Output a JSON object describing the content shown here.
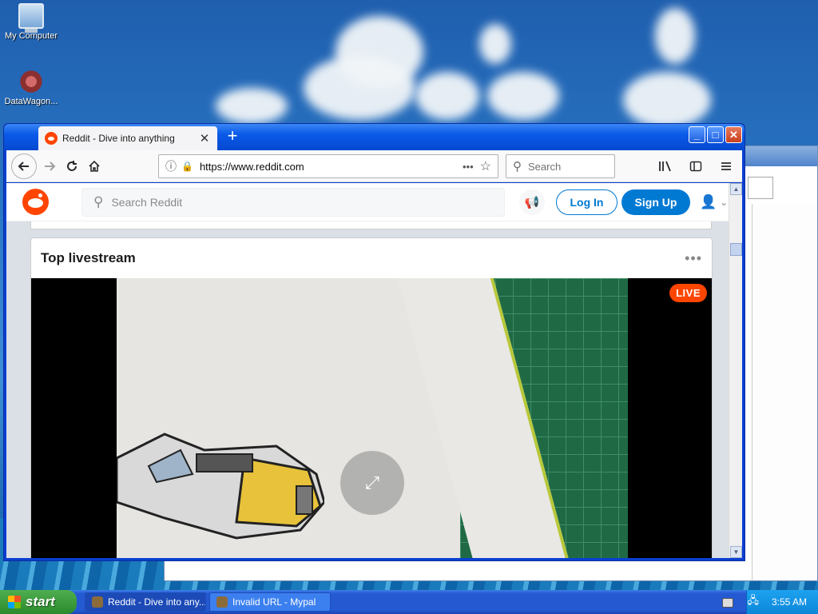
{
  "desktop": {
    "icons": [
      {
        "label": "My Computer"
      },
      {
        "label": "DataWagon..."
      }
    ]
  },
  "browser": {
    "tab_title": "Reddit - Dive into anything",
    "tab_close": "✕",
    "new_tab": "+",
    "url": "https://www.reddit.com",
    "search_placeholder": "Search",
    "page_actions": "•••"
  },
  "reddit": {
    "search_placeholder": "Search Reddit",
    "login_label": "Log In",
    "signup_label": "Sign Up",
    "card_title": "Top livestream",
    "card_more": "•••",
    "live_badge": "LIVE"
  },
  "taskbar": {
    "start_label": "start",
    "items": [
      {
        "label": "Reddit - Dive into any..."
      },
      {
        "label": "Invalid URL - Mypal"
      }
    ],
    "clock": "3:55 AM"
  },
  "colors": {
    "reddit_orange": "#ff4500",
    "reddit_blue": "#0079d3",
    "xp_blue": "#2459d2"
  }
}
